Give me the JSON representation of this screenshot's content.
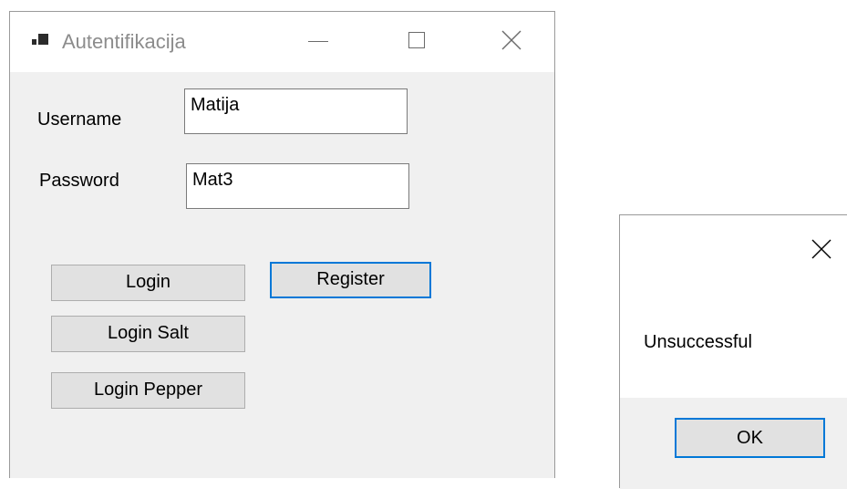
{
  "window": {
    "title": "Autentifikacija",
    "username_label": "Username",
    "username_value": "Matija",
    "password_label": "Password",
    "password_value": "Mat3",
    "buttons": {
      "login": "Login",
      "login_salt": "Login Salt",
      "login_pepper": "Login Pepper",
      "register": "Register"
    },
    "icons": {
      "app": "app-icon",
      "minimize": "minimize-icon",
      "maximize": "maximize-icon",
      "close": "close-icon"
    }
  },
  "dialog": {
    "message": "Unsuccessful",
    "ok_label": "OK",
    "close_icon": "close-icon"
  },
  "colors": {
    "focus": "#0078d7",
    "window_bg": "#f0f0f0",
    "button_bg": "#e1e1e1"
  }
}
